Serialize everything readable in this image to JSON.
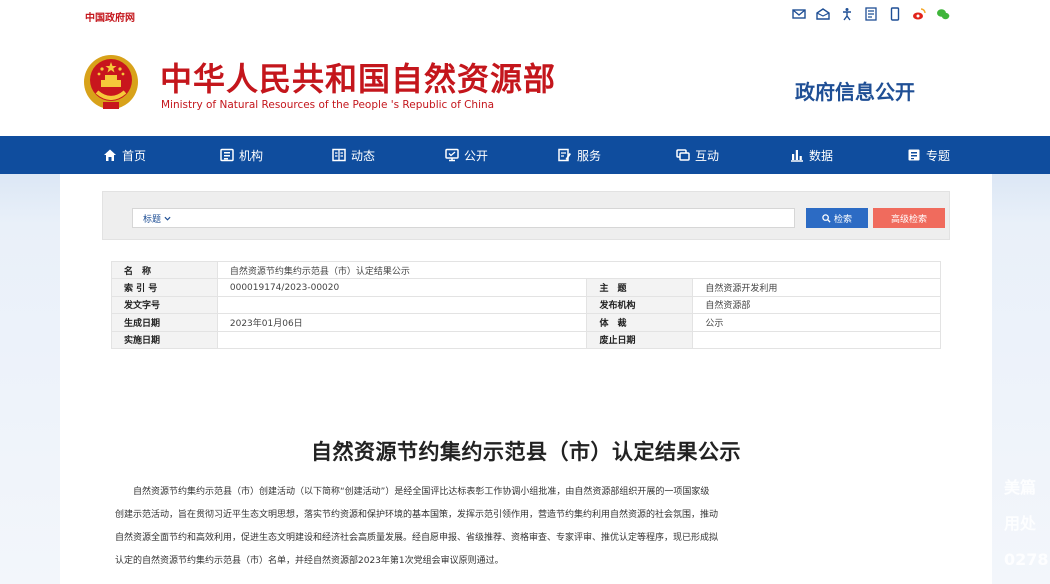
{
  "topbar": {
    "gov_link": "中国政府网",
    "icons": [
      "mail-icon",
      "mail-open-icon",
      "accessibility-icon",
      "rss-icon",
      "mobile-icon",
      "weibo-icon",
      "wechat-icon"
    ]
  },
  "header": {
    "title": "中华人民共和国自然资源部",
    "subtitle": "Ministry of Natural Resources of the People 's Republic of China",
    "gov_info": "政府信息公开"
  },
  "nav": {
    "items": [
      {
        "label": "首页",
        "icon": "home-icon"
      },
      {
        "label": "机构",
        "icon": "org-icon"
      },
      {
        "label": "动态",
        "icon": "news-icon"
      },
      {
        "label": "公开",
        "icon": "disclosure-icon"
      },
      {
        "label": "服务",
        "icon": "service-icon"
      },
      {
        "label": "互动",
        "icon": "interact-icon"
      },
      {
        "label": "数据",
        "icon": "data-icon"
      },
      {
        "label": "专题",
        "icon": "topic-icon"
      }
    ]
  },
  "search": {
    "field_label": "标题",
    "search_label": "检索",
    "advanced_label": "高级检索"
  },
  "info": {
    "name_label": "名　称",
    "name_value": "自然资源节约集约示范县（市）认定结果公示",
    "index_label": "索 引 号",
    "index_value": "000019174/2023-00020",
    "topic_label": "主　题",
    "topic_value": "自然资源开发利用",
    "docno_label": "发文字号",
    "docno_value": "",
    "publisher_label": "发布机构",
    "publisher_value": "自然资源部",
    "gendate_label": "生成日期",
    "gendate_value": "2023年01月06日",
    "genre_label": "体　裁",
    "genre_value": "公示",
    "effdate_label": "实施日期",
    "effdate_value": "",
    "expdate_label": "废止日期",
    "expdate_value": ""
  },
  "article": {
    "title": "自然资源节约集约示范县（市）认定结果公示",
    "lines": [
      "　　自然资源节约集约示范县（市）创建活动（以下简称“创建活动”）是经全国评比达标表彰工作协调小组批准，由自然资源部组织开展的一项国家级",
      "创建示范活动，旨在贯彻习近平生态文明思想，落实节约资源和保护环境的基本国策，发挥示范引领作用，营造节约集约利用自然资源的社会氛围，推动",
      "自然资源全面节约和高效利用，促进生态文明建设和经济社会高质量发展。经自愿申报、省级推荐、资格审查、专家评审、推优认定等程序，现已形成拟",
      "认定的自然资源节约集约示范县（市）名单，并经自然资源部2023年第1次党组会审议原则通过。"
    ]
  },
  "overlay": {
    "lines": [
      "美篇",
      "用处",
      "0278"
    ]
  },
  "colors": {
    "brand_red": "#c4161c",
    "nav_blue": "#0f4d9e",
    "search_blue": "#2c6bc4",
    "adv_red": "#f06b5d"
  }
}
